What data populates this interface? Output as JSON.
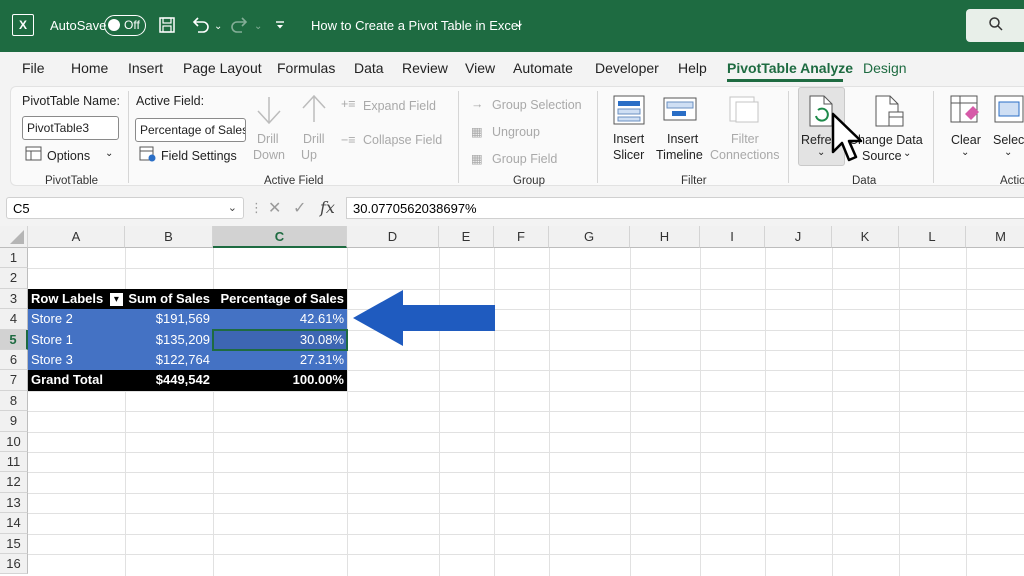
{
  "titlebar": {
    "autosave_label": "AutoSave",
    "autosave_state": "Off",
    "document_title": "How to Create a Pivot Table in Excel",
    "title_chevron": "⌄"
  },
  "tabs": [
    "File",
    "Home",
    "Insert",
    "Page Layout",
    "Formulas",
    "Data",
    "Review",
    "View",
    "Automate",
    "Developer",
    "Help",
    "PivotTable Analyze",
    "Design"
  ],
  "active_tab": "PivotTable Analyze",
  "ribbon": {
    "pivottable_name_label": "PivotTable Name:",
    "pivottable_name_value": "PivotTable3",
    "options_label": "Options",
    "group_pivottable": "PivotTable",
    "active_field_label": "Active Field:",
    "active_field_value": "Percentage of Sales",
    "field_settings_label": "Field Settings",
    "drill_down_1": "Drill",
    "drill_down_2": "Down",
    "drill_up_1": "Drill",
    "drill_up_2": "Up",
    "expand_field": "Expand Field",
    "collapse_field": "Collapse Field",
    "group_active_field": "Active Field",
    "group_selection": "Group Selection",
    "ungroup": "Ungroup",
    "group_field": "Group Field",
    "group_group": "Group",
    "insert_slicer_1": "Insert",
    "insert_slicer_2": "Slicer",
    "insert_timeline_1": "Insert",
    "insert_timeline_2": "Timeline",
    "filter_connections_1": "Filter",
    "filter_connections_2": "Connections",
    "group_filter": "Filter",
    "refresh": "Refre",
    "change_data_source_1": "Change Data",
    "change_data_source_2": "Source",
    "group_data": "Data",
    "clear": "Clear",
    "select": "Select",
    "group_actions": "Actio"
  },
  "formula_bar": {
    "name_box": "C5",
    "formula": "30.0770562038697%",
    "fx_label": "fx"
  },
  "columns": [
    "A",
    "B",
    "C",
    "D",
    "E",
    "F",
    "G",
    "H",
    "I",
    "J",
    "K",
    "L",
    "M"
  ],
  "rows": [
    "1",
    "2",
    "3",
    "4",
    "5",
    "6",
    "7",
    "8",
    "9",
    "10",
    "11",
    "12",
    "13",
    "14",
    "15",
    "16"
  ],
  "pivot": {
    "headers": [
      "Row Labels",
      "Sum of Sales",
      "Percentage of Sales"
    ],
    "filter_glyph": "▾",
    "rows": [
      {
        "label": "Store 2",
        "sales": "$191,569",
        "pct": "42.61%"
      },
      {
        "label": "Store 1",
        "sales": "$135,209",
        "pct": "30.08%"
      },
      {
        "label": "Store 3",
        "sales": "$122,764",
        "pct": "27.31%"
      }
    ],
    "total": {
      "label": "Grand Total",
      "sales": "$449,542",
      "pct": "100.00%"
    }
  },
  "colors": {
    "excel_green": "#1e6b41",
    "pivot_row_blue": "#4472c4",
    "arrow_blue": "#1f5bbf"
  }
}
